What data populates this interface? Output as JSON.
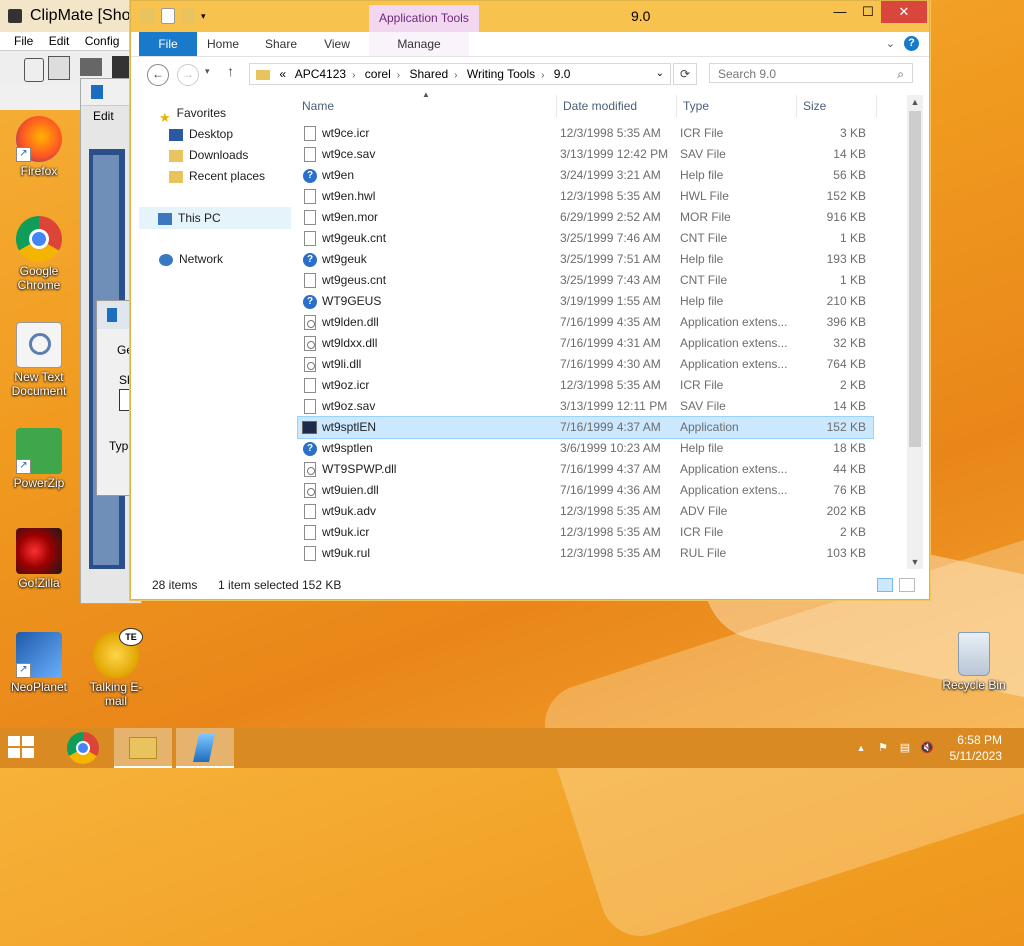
{
  "clipmate": {
    "title": "ClipMate [Shor",
    "menu": [
      "File",
      "Edit",
      "Config"
    ],
    "child_menu": "Edit",
    "child_label": "Ge",
    "child_label2": "Sh",
    "child_label3": "Type"
  },
  "desktop_icons": [
    {
      "label": "Firefox",
      "icon": "firefox-icon"
    },
    {
      "label": "Google Chrome",
      "icon": "chrome-icon"
    },
    {
      "label": "New Text Document",
      "icon": "text-document-icon"
    },
    {
      "label": "PowerZip",
      "icon": "powerzip-icon"
    },
    {
      "label": "Go!Zilla",
      "icon": "gozilla-icon"
    },
    {
      "label": "NeoPlanet",
      "icon": "neoplanet-icon"
    },
    {
      "label": "Talking E-mail",
      "icon": "talking-email-icon"
    },
    {
      "label": "Recycle Bin",
      "icon": "recycle-bin-icon"
    }
  ],
  "explorer": {
    "title": "9.0",
    "contextual_tab": "Application Tools",
    "ribbon_tabs": {
      "file": "File",
      "home": "Home",
      "share": "Share",
      "view": "View",
      "manage": "Manage"
    },
    "help": "?",
    "address": {
      "prefix": "«",
      "crumbs": [
        "APC4123",
        "corel",
        "Shared",
        "Writing Tools",
        "9.0"
      ]
    },
    "search_placeholder": "Search 9.0",
    "nav": {
      "favorites": "Favorites",
      "desktop": "Desktop",
      "downloads": "Downloads",
      "recent": "Recent places",
      "this_pc": "This PC",
      "network": "Network"
    },
    "columns": {
      "name": "Name",
      "date": "Date modified",
      "type": "Type",
      "size": "Size"
    },
    "files": [
      {
        "name": "wt9ce.icr",
        "date": "12/3/1998 5:35 AM",
        "type": "ICR File",
        "size": "3 KB",
        "icon": "doc"
      },
      {
        "name": "wt9ce.sav",
        "date": "3/13/1999 12:42 PM",
        "type": "SAV File",
        "size": "14 KB",
        "icon": "doc"
      },
      {
        "name": "wt9en",
        "date": "3/24/1999 3:21 AM",
        "type": "Help file",
        "size": "56 KB",
        "icon": "help"
      },
      {
        "name": "wt9en.hwl",
        "date": "12/3/1998 5:35 AM",
        "type": "HWL File",
        "size": "152 KB",
        "icon": "doc"
      },
      {
        "name": "wt9en.mor",
        "date": "6/29/1999 2:52 AM",
        "type": "MOR File",
        "size": "916 KB",
        "icon": "doc"
      },
      {
        "name": "wt9geuk.cnt",
        "date": "3/25/1999 7:46 AM",
        "type": "CNT File",
        "size": "1 KB",
        "icon": "doc"
      },
      {
        "name": "wt9geuk",
        "date": "3/25/1999 7:51 AM",
        "type": "Help file",
        "size": "193 KB",
        "icon": "help"
      },
      {
        "name": "wt9geus.cnt",
        "date": "3/25/1999 7:43 AM",
        "type": "CNT File",
        "size": "1 KB",
        "icon": "doc"
      },
      {
        "name": "WT9GEUS",
        "date": "3/19/1999 1:55 AM",
        "type": "Help file",
        "size": "210 KB",
        "icon": "help"
      },
      {
        "name": "wt9lden.dll",
        "date": "7/16/1999 4:35 AM",
        "type": "Application extens...",
        "size": "396 KB",
        "icon": "dll"
      },
      {
        "name": "wt9ldxx.dll",
        "date": "7/16/1999 4:31 AM",
        "type": "Application extens...",
        "size": "32 KB",
        "icon": "dll"
      },
      {
        "name": "wt9li.dll",
        "date": "7/16/1999 4:30 AM",
        "type": "Application extens...",
        "size": "764 KB",
        "icon": "dll"
      },
      {
        "name": "wt9oz.icr",
        "date": "12/3/1998 5:35 AM",
        "type": "ICR File",
        "size": "2 KB",
        "icon": "doc"
      },
      {
        "name": "wt9oz.sav",
        "date": "3/13/1999 12:11 PM",
        "type": "SAV File",
        "size": "14 KB",
        "icon": "doc"
      },
      {
        "name": "wt9sptlEN",
        "date": "7/16/1999 4:37 AM",
        "type": "Application",
        "size": "152 KB",
        "icon": "app",
        "selected": true
      },
      {
        "name": "wt9sptlen",
        "date": "3/6/1999 10:23 AM",
        "type": "Help file",
        "size": "18 KB",
        "icon": "help"
      },
      {
        "name": "WT9SPWP.dll",
        "date": "7/16/1999 4:37 AM",
        "type": "Application extens...",
        "size": "44 KB",
        "icon": "dll"
      },
      {
        "name": "wt9uien.dll",
        "date": "7/16/1999 4:36 AM",
        "type": "Application extens...",
        "size": "76 KB",
        "icon": "dll"
      },
      {
        "name": "wt9uk.adv",
        "date": "12/3/1998 5:35 AM",
        "type": "ADV File",
        "size": "202 KB",
        "icon": "doc"
      },
      {
        "name": "wt9uk.icr",
        "date": "12/3/1998 5:35 AM",
        "type": "ICR File",
        "size": "2 KB",
        "icon": "doc"
      },
      {
        "name": "wt9uk.rul",
        "date": "12/3/1998 5:35 AM",
        "type": "RUL File",
        "size": "103 KB",
        "icon": "doc"
      }
    ],
    "status": {
      "items": "28 items",
      "selected": "1 item selected",
      "size": "152 KB"
    }
  },
  "taskbar": {
    "time": "6:58 PM",
    "date": "5/11/2023",
    "apps": [
      "chrome-icon",
      "file-explorer-icon",
      "writing-tools-icon"
    ]
  },
  "colors": {
    "titlebar": "#f7c24d",
    "accent": "#1979ca",
    "selection": "#cce8ff",
    "close": "#d9463b"
  }
}
